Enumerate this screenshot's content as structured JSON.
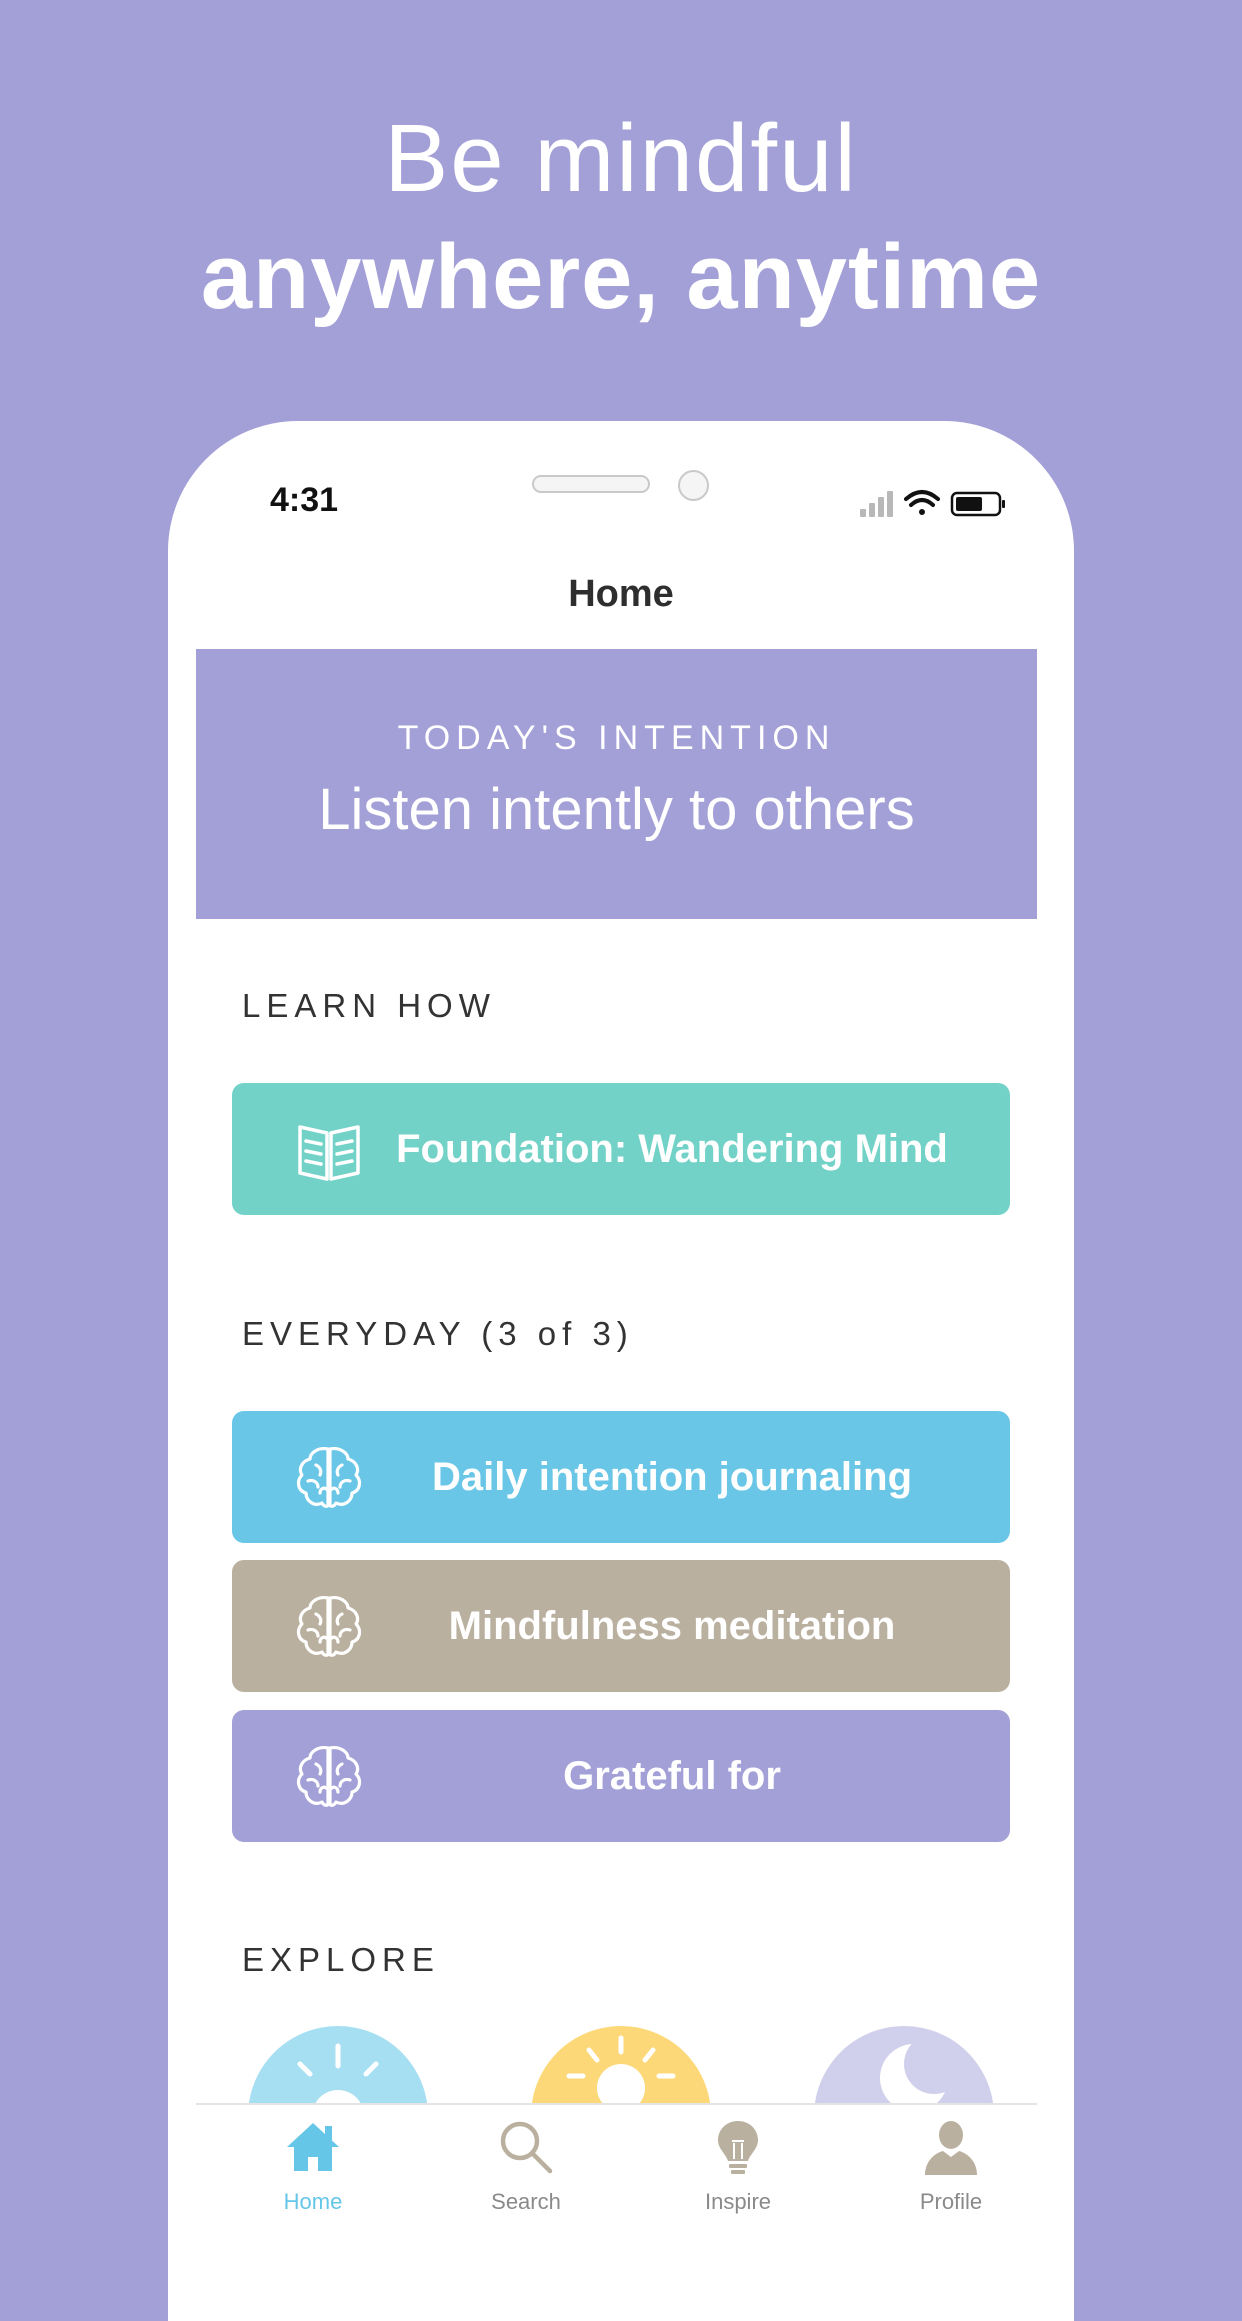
{
  "headline": {
    "line1": "Be mindful",
    "line2": "anywhere, anytime"
  },
  "status_bar": {
    "time": "4:31"
  },
  "nav": {
    "title": "Home"
  },
  "intention": {
    "label": "TODAY'S INTENTION",
    "text": "Listen intently to others"
  },
  "sections": {
    "learn_how": "LEARN HOW",
    "everyday": "EVERYDAY (3 of 3)",
    "explore": "EXPLORE"
  },
  "learn_card": {
    "label": "Foundation: Wandering Mind",
    "icon": "book-icon",
    "color": "#72d2c7"
  },
  "everyday_cards": [
    {
      "label": "Daily intention journaling",
      "icon": "brain-icon",
      "color": "#69c6e6"
    },
    {
      "label": "Mindfulness meditation",
      "icon": "brain-icon",
      "color": "#bab09f"
    },
    {
      "label": "Grateful for",
      "icon": "brain-icon",
      "color": "#a2a0d7"
    }
  ],
  "explore_items": [
    {
      "icon": "sun-icon",
      "color": "#a7dff2"
    },
    {
      "icon": "sunrise-icon",
      "color": "#fcd879"
    },
    {
      "icon": "moon-icon",
      "color": "#d1d0ec"
    }
  ],
  "tabs": [
    {
      "label": "Home",
      "icon": "home-icon",
      "active": true
    },
    {
      "label": "Search",
      "icon": "search-icon",
      "active": false
    },
    {
      "label": "Inspire",
      "icon": "lightbulb-icon",
      "active": false
    },
    {
      "label": "Profile",
      "icon": "person-icon",
      "active": false
    }
  ],
  "colors": {
    "background": "#a2a0d7",
    "tab_active": "#66c6e7",
    "tab_inactive": "#8a8a8a"
  }
}
